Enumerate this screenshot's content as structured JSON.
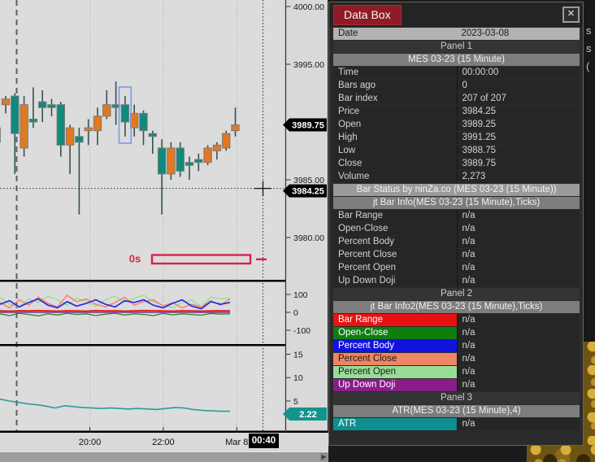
{
  "databox": {
    "title": "Data Box",
    "close_label": "✕",
    "rows": [
      {
        "t": "date",
        "label": "Date",
        "value": "2023-03-08"
      },
      {
        "t": "panel",
        "text": "Panel 1"
      },
      {
        "t": "instr",
        "text": "MES 03-23 (15 Minute)"
      },
      {
        "t": "kv",
        "label": "Time",
        "value": "00:00:00"
      },
      {
        "t": "kv",
        "label": "Bars ago",
        "value": "0"
      },
      {
        "t": "kv",
        "label": "Bar index",
        "value": "207 of 207"
      },
      {
        "t": "kv",
        "label": "Price",
        "value": "3984.25"
      },
      {
        "t": "kv",
        "label": "Open",
        "value": "3989.25"
      },
      {
        "t": "kv",
        "label": "High",
        "value": "3991.25"
      },
      {
        "t": "kv",
        "label": "Low",
        "value": "3988.75"
      },
      {
        "t": "kv",
        "label": "Close",
        "value": "3989.75"
      },
      {
        "t": "kv",
        "label": "Volume",
        "value": "2,273"
      },
      {
        "t": "instr",
        "text": "Bar Status by ninZa.co (MES 03-23 (15 Minute))",
        "bg": "#9a9a9a"
      },
      {
        "t": "instr",
        "text": "jt Bar Info(MES 03-23 (15 Minute),Ticks)"
      },
      {
        "t": "kv",
        "label": "Bar Range",
        "value": "n/a"
      },
      {
        "t": "kv",
        "label": "Open-Close",
        "value": "n/a"
      },
      {
        "t": "kv",
        "label": "Percent Body",
        "value": "n/a"
      },
      {
        "t": "kv",
        "label": "Percent Close",
        "value": "n/a"
      },
      {
        "t": "kv",
        "label": "Percent Open",
        "value": "n/a"
      },
      {
        "t": "kv",
        "label": "Up Down Doji",
        "value": "n/a"
      },
      {
        "t": "panel",
        "text": "Panel 2"
      },
      {
        "t": "instr",
        "text": "jt Bar Info2(MES 03-23 (15 Minute),Ticks)"
      },
      {
        "t": "ckv",
        "label": "Bar Range",
        "value": "n/a",
        "bg": "#e81212",
        "fg": "#ffffff"
      },
      {
        "t": "ckv",
        "label": "Open-Close",
        "value": "n/a",
        "bg": "#0e7e0e",
        "fg": "#ffffff"
      },
      {
        "t": "ckv",
        "label": "Percent Body",
        "value": "n/a",
        "bg": "#1212e0",
        "fg": "#ffffff"
      },
      {
        "t": "ckv",
        "label": "Percent Close",
        "value": "n/a",
        "bg": "#f08563",
        "fg": "#1a1a1a"
      },
      {
        "t": "ckv",
        "label": "Percent Open",
        "value": "n/a",
        "bg": "#97dc97",
        "fg": "#1a1a1a"
      },
      {
        "t": "ckv",
        "label": "Up Down Doji",
        "value": "n/a",
        "bg": "#8a1d8a",
        "fg": "#ffffff"
      },
      {
        "t": "panel",
        "text": "Panel 3"
      },
      {
        "t": "instr",
        "text": "ATR(MES 03-23 (15 Minute),4)"
      },
      {
        "t": "ckv",
        "label": "ATR",
        "value": "n/a",
        "bg": "#0e8f8f",
        "fg": "#ffffff"
      }
    ]
  },
  "chart": {
    "annotation_label": "0s",
    "annotation_color": "#d6234c",
    "price_ticks": [
      {
        "label": "4000.00",
        "price": 4000.0
      },
      {
        "label": "3995.00",
        "price": 3995.0
      },
      {
        "label": "3985.00",
        "price": 3985.0
      },
      {
        "label": "3980.00",
        "price": 3980.0
      }
    ],
    "last_price_tag": {
      "label": "3989.75",
      "price": 3989.75,
      "bg": "#000000",
      "fg": "#ffffff"
    },
    "crosshair_tag": {
      "label": "3984.25",
      "price": 3984.25,
      "bg": "#000000",
      "fg": "#ffffff"
    },
    "atr_tag": {
      "label": "2.22",
      "value": 2.22,
      "bg": "#12948c",
      "fg": "#ffffff"
    },
    "panel2_ticks": [
      {
        "label": "100",
        "v": 100
      },
      {
        "label": "0",
        "v": 0
      },
      {
        "label": "-100",
        "v": -100
      }
    ],
    "panel3_ticks": [
      {
        "label": "15",
        "v": 15
      },
      {
        "label": "10",
        "v": 10
      },
      {
        "label": "5",
        "v": 5
      }
    ],
    "time_labels": [
      {
        "text": "20:00",
        "x": 110.5
      },
      {
        "text": "22:00",
        "x": 200.9
      },
      {
        "text": "Mar 8",
        "x": 291.3
      }
    ],
    "crosshair_time_tag": "00:40"
  },
  "chart_data": [
    {
      "type": "candlestick",
      "panel": "Panel 1",
      "instrument": "MES 03-23 (15 Minute)",
      "ylim": [
        3977.5,
        4000.5
      ],
      "up_color": "#0f8a7c",
      "down_color": "#e0791f",
      "highlighted_bar_index": 14,
      "candles": [
        {
          "o": 3989.5,
          "h": 3989.5,
          "l": 3988.25,
          "c": 3988.25,
          "color": "orange"
        },
        {
          "o": 3992.0,
          "h": 3992.25,
          "l": 3990.75,
          "c": 3991.5,
          "color": "orange"
        },
        {
          "o": 3989.0,
          "h": 3992.5,
          "l": 3985.5,
          "c": 3992.25,
          "color": "teal"
        },
        {
          "o": 3991.5,
          "h": 3992.25,
          "l": 3987.0,
          "c": 3987.75,
          "color": "orange"
        },
        {
          "o": 3990.0,
          "h": 3993.0,
          "l": 3989.5,
          "c": 3990.25,
          "color": "teal"
        },
        {
          "o": 3991.25,
          "h": 3992.75,
          "l": 3990.0,
          "c": 3991.75,
          "color": "teal"
        },
        {
          "o": 3991.25,
          "h": 3992.0,
          "l": 3990.5,
          "c": 3991.5,
          "color": "teal"
        },
        {
          "o": 3988.0,
          "h": 3991.75,
          "l": 3987.0,
          "c": 3991.5,
          "color": "teal"
        },
        {
          "o": 3989.5,
          "h": 3989.75,
          "l": 3985.5,
          "c": 3988.0,
          "color": "orange"
        },
        {
          "o": 3988.25,
          "h": 3989.5,
          "l": 3982.0,
          "c": 3988.75,
          "color": "teal"
        },
        {
          "o": 3989.5,
          "h": 3990.25,
          "l": 3988.0,
          "c": 3989.25,
          "color": "orange"
        },
        {
          "o": 3990.5,
          "h": 3991.25,
          "l": 3988.0,
          "c": 3989.25,
          "color": "orange"
        },
        {
          "o": 3991.5,
          "h": 3992.75,
          "l": 3990.25,
          "c": 3990.5,
          "color": "orange"
        },
        {
          "o": 3991.25,
          "h": 3993.5,
          "l": 3989.75,
          "c": 3991.5,
          "color": "teal"
        },
        {
          "o": 3990.0,
          "h": 3992.25,
          "l": 3988.75,
          "c": 3991.5,
          "color": "teal"
        },
        {
          "o": 3990.75,
          "h": 3991.5,
          "l": 3988.75,
          "c": 3989.5,
          "color": "orange"
        },
        {
          "o": 3989.25,
          "h": 3991.0,
          "l": 3988.0,
          "c": 3990.75,
          "color": "teal"
        },
        {
          "o": 3988.75,
          "h": 3989.25,
          "l": 3987.25,
          "c": 3989.0,
          "color": "teal"
        },
        {
          "o": 3985.5,
          "h": 3988.5,
          "l": 3982.0,
          "c": 3987.75,
          "color": "teal"
        },
        {
          "o": 3987.75,
          "h": 3988.25,
          "l": 3985.0,
          "c": 3985.5,
          "color": "orange"
        },
        {
          "o": 3985.75,
          "h": 3988.25,
          "l": 3985.25,
          "c": 3987.75,
          "color": "teal"
        },
        {
          "o": 3986.25,
          "h": 3987.0,
          "l": 3985.0,
          "c": 3986.5,
          "color": "teal"
        },
        {
          "o": 3986.5,
          "h": 3987.25,
          "l": 3985.75,
          "c": 3986.75,
          "color": "teal"
        },
        {
          "o": 3987.75,
          "h": 3988.0,
          "l": 3986.25,
          "c": 3986.5,
          "color": "orange"
        },
        {
          "o": 3988.0,
          "h": 3988.25,
          "l": 3986.75,
          "c": 3987.5,
          "color": "orange"
        },
        {
          "o": 3989.0,
          "h": 3989.25,
          "l": 3987.5,
          "c": 3987.75,
          "color": "orange"
        },
        {
          "o": 3989.25,
          "h": 3991.25,
          "l": 3988.75,
          "c": 3989.75,
          "color": "orange"
        }
      ]
    },
    {
      "type": "line",
      "panel": "Panel 2",
      "ylim": [
        -120,
        120
      ],
      "series": [
        {
          "name": "Open-Close",
          "color": "#1f8a1f",
          "width": 1.3,
          "values": [
            -8,
            -18,
            -5,
            -12,
            -20,
            -8,
            -15,
            -5,
            -12,
            -8,
            -18,
            -10,
            -5,
            -15,
            -8,
            -12,
            -18,
            -6,
            -14,
            -8,
            -12,
            -16,
            -6,
            -10,
            -8
          ]
        },
        {
          "name": "Percent Open",
          "color": "#98e098",
          "width": 1.5,
          "values": [
            85,
            45,
            30,
            75,
            55,
            90,
            70,
            40,
            80,
            60,
            35,
            70,
            90,
            55,
            80,
            95,
            60,
            40,
            25,
            55,
            70,
            30,
            85,
            75,
            80
          ]
        },
        {
          "name": "Percent Close",
          "color": "#f4826a",
          "width": 1.5,
          "values": [
            55,
            25,
            70,
            40,
            85,
            50,
            30,
            95,
            60,
            75,
            45,
            30,
            55,
            85,
            40,
            60,
            70,
            35,
            55,
            25,
            45,
            30,
            65,
            40,
            75
          ]
        },
        {
          "name": "Percent Body",
          "color": "#2828e8",
          "width": 1.7,
          "values": [
            45,
            65,
            30,
            55,
            75,
            40,
            25,
            60,
            35,
            50,
            70,
            45,
            30,
            65,
            55,
            70,
            40,
            25,
            50,
            70,
            35,
            20,
            60,
            45,
            55
          ]
        },
        {
          "name": "Up Down Doji",
          "color": "#8a2a8a",
          "width": 1.6,
          "values": [
            0,
            0,
            0,
            0,
            0,
            0,
            0,
            0,
            0,
            0,
            0,
            0,
            0,
            0,
            0,
            0,
            0,
            0,
            0,
            0,
            0,
            0,
            0,
            0,
            0
          ]
        },
        {
          "name": "Bar Range",
          "color": "#e02020",
          "width": 1.8,
          "values": [
            8,
            7,
            9,
            8,
            10,
            8,
            7,
            9,
            8,
            7,
            10,
            8,
            9,
            7,
            8,
            10,
            9,
            8,
            7,
            9,
            8,
            7,
            8,
            9,
            8
          ]
        }
      ]
    },
    {
      "type": "line",
      "panel": "Panel 3",
      "ylim": [
        0,
        17.5
      ],
      "series": [
        {
          "name": "ATR",
          "color": "#2a9d97",
          "width": 1.6,
          "values": [
            5.4,
            5.0,
            4.7,
            4.4,
            4.2,
            3.9,
            3.5,
            4.0,
            3.8,
            3.6,
            3.5,
            3.4,
            3.5,
            3.4,
            3.3,
            3.4,
            3.3,
            3.2,
            3.4,
            3.6,
            3.5,
            3.2,
            3.0,
            2.9,
            2.8,
            2.8
          ]
        }
      ]
    }
  ],
  "fragments": [
    "s",
    "s",
    "("
  ]
}
